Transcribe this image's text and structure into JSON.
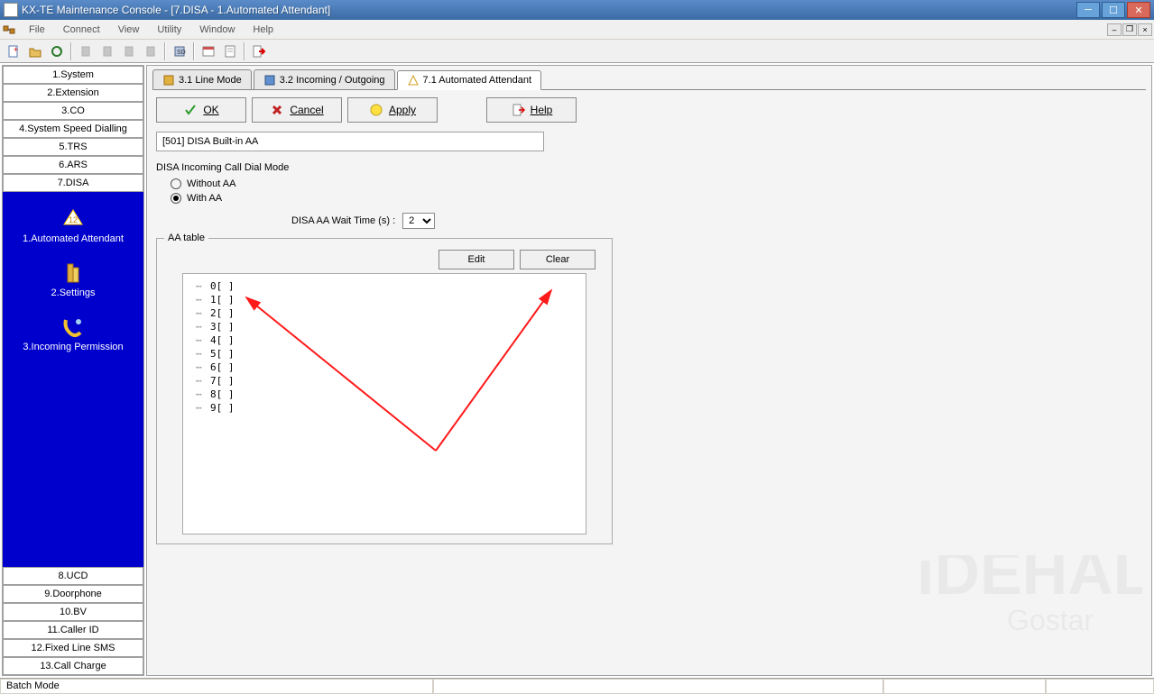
{
  "window": {
    "title": "KX-TE Maintenance Console - [7.DISA - 1.Automated Attendant]"
  },
  "menubar": {
    "items": [
      "File",
      "Connect",
      "View",
      "Utility",
      "Window",
      "Help"
    ]
  },
  "sidebar": {
    "top_items": [
      "1.System",
      "2.Extension",
      "3.CO",
      "4.System Speed Dialling",
      "5.TRS",
      "6.ARS",
      "7.DISA"
    ],
    "sub_items": [
      {
        "label": "1.Automated Attendant"
      },
      {
        "label": "2.Settings"
      },
      {
        "label": "3.Incoming Permission"
      }
    ],
    "bottom_items": [
      "8.UCD",
      "9.Doorphone",
      "10.BV",
      "11.Caller ID",
      "12.Fixed Line SMS",
      "13.Call Charge"
    ]
  },
  "tabs": {
    "items": [
      {
        "label": "3.1 Line Mode",
        "active": false
      },
      {
        "label": "3.2 Incoming / Outgoing",
        "active": false
      },
      {
        "label": "7.1 Automated Attendant",
        "active": true
      }
    ]
  },
  "buttons": {
    "ok": "OK",
    "cancel": "Cancel",
    "apply": "Apply",
    "help": "Help",
    "edit": "Edit",
    "clear": "Clear"
  },
  "panel": {
    "field_label": "[501] DISA Built-in AA",
    "section_label": "DISA Incoming Call Dial Mode",
    "radio1": "Without AA",
    "radio2": "With AA",
    "radio_selected": "with",
    "wait_label": "DISA AA Wait Time (s) :",
    "wait_value": "2",
    "groupbox_title": "AA table",
    "tree_items": [
      "0[ ]",
      "1[ ]",
      "2[ ]",
      "3[ ]",
      "4[ ]",
      "5[ ]",
      "6[ ]",
      "7[ ]",
      "8[ ]",
      "9[ ]"
    ]
  },
  "statusbar": {
    "text": "Batch Mode"
  }
}
